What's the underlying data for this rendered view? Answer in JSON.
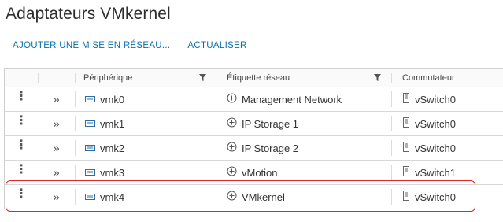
{
  "page": {
    "title": "Adaptateurs VMkernel"
  },
  "toolbar": {
    "add_label": "AJOUTER UNE MISE EN RÉSEAU...",
    "refresh_label": "ACTUALISER"
  },
  "table": {
    "columns": {
      "device": "Périphérique",
      "label": "Étiquette réseau",
      "switch": "Commutateur"
    },
    "rows": [
      {
        "device": "vmk0",
        "label": "Management Network",
        "switch": "vSwitch0"
      },
      {
        "device": "vmk1",
        "label": "IP Storage 1",
        "switch": "vSwitch0"
      },
      {
        "device": "vmk2",
        "label": "IP Storage 2",
        "switch": "vSwitch0"
      },
      {
        "device": "vmk3",
        "label": "vMotion",
        "switch": "vSwitch1"
      },
      {
        "device": "vmk4",
        "label": "VMkernel",
        "switch": "vSwitch0"
      }
    ],
    "highlighted_row": "vmk4"
  },
  "colors": {
    "accent": "#0b6ea8",
    "highlight": "#e0242a"
  },
  "icons": [
    "kebab-menu-icon",
    "expand-chevron-icon",
    "nic-icon",
    "portgroup-icon",
    "vswitch-icon",
    "filter-icon"
  ]
}
